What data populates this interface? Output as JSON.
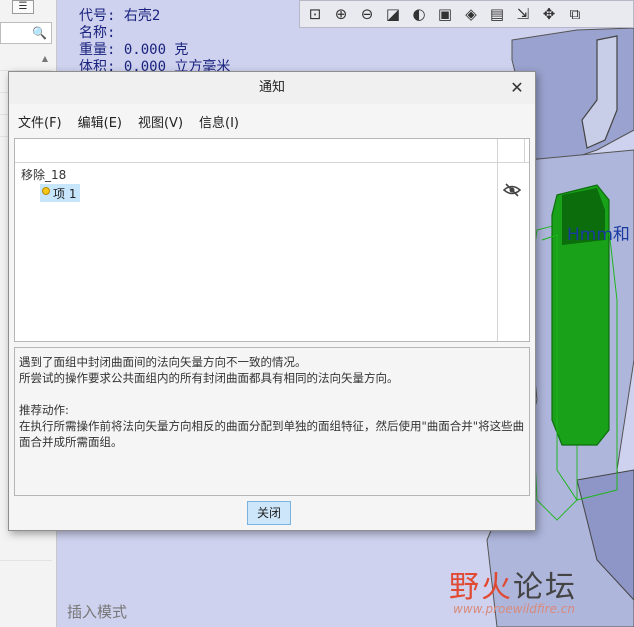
{
  "model_info": {
    "code": "代号: 右壳2",
    "name": "名称:",
    "weight": "重量: 0.000 克",
    "volume": "体积: 0.000 立方毫米"
  },
  "status": {
    "mode": "插入模式"
  },
  "graphics_label": "Hmm和",
  "watermark": {
    "title_a": "野火",
    "title_b": "论坛",
    "url": "www.proewildfire.cn"
  },
  "dialog": {
    "title": "通知",
    "menu": [
      "文件(F)",
      "编辑(E)",
      "视图(V)",
      "信息(I)"
    ],
    "tree": {
      "root": "移除_18",
      "child": "项 1"
    },
    "message": {
      "line1": "遇到了面组中封闭曲面间的法向矢量方向不一致的情况。",
      "line2": "所尝试的操作要求公共面组内的所有封闭曲面都具有相同的法向矢量方向。",
      "action_title": "推荐动作:",
      "action_text": "在执行所需操作前将法向矢量方向相反的曲面分配到单独的面组特征，然后使用\"曲面合并\"将这些曲面合并成所需面组。"
    },
    "close_label": "关闭"
  },
  "colors": {
    "green_model": "#1aa51a",
    "dialog_bg": "#f5f5f5",
    "selection": "#c7e6fb"
  }
}
